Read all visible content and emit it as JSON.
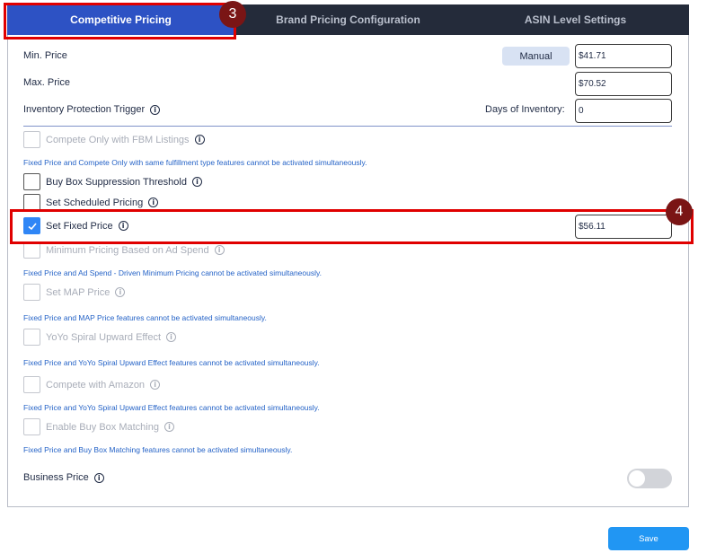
{
  "tabs": [
    {
      "label": "Competitive Pricing",
      "active": true
    },
    {
      "label": "Brand Pricing Configuration",
      "active": false
    },
    {
      "label": "ASIN Level Settings",
      "active": false
    }
  ],
  "fields": {
    "min_price_label": "Min. Price",
    "manual_label": "Manual",
    "min_price_value": "$41.71",
    "max_price_label": "Max. Price",
    "max_price_value": "$70.52",
    "inventory_trigger_label": "Inventory Protection Trigger",
    "days_of_inventory_label": "Days of Inventory:",
    "days_of_inventory_value": "0"
  },
  "options": {
    "compete_fbm": "Compete Only with FBM Listings",
    "note_fbm": "Fixed Price and Compete Only with same fulfillment type features cannot be activated simultaneously.",
    "buy_box_suppression": "Buy Box Suppression Threshold",
    "scheduled_pricing": "Set Scheduled Pricing",
    "fixed_price": "Set Fixed Price",
    "fixed_price_value": "$56.11",
    "min_pricing_ad_spend": "Minimum Pricing Based on Ad Spend",
    "note_ad_spend": "Fixed Price and Ad Spend - Driven Minimum Pricing cannot be activated simultaneously.",
    "map_price": "Set MAP Price",
    "note_map": "Fixed Price and MAP Price features cannot be activated simultaneously.",
    "yoyo": "YoYo Spiral Upward Effect",
    "note_yoyo": "Fixed Price and YoYo Spiral Upward Effect features cannot be activated simultaneously.",
    "compete_amazon": "Compete with Amazon",
    "note_amazon": "Fixed Price and YoYo Spiral Upward Effect features cannot be activated simultaneously.",
    "buy_box_matching": "Enable Buy Box Matching",
    "note_buy_box": "Fixed Price and Buy Box Matching features cannot be activated simultaneously.",
    "business_price": "Business Price"
  },
  "info_glyph": "i",
  "save_label": "Save",
  "annotations": {
    "badge_3": "3",
    "badge_4": "4"
  },
  "colors": {
    "active_tab": "#2d52c4",
    "tab_bar": "#242b3a",
    "checked": "#2f86f6",
    "highlight": "#e00000",
    "badge": "#7a1515",
    "save": "#2196f3",
    "note": "#2563c7"
  }
}
